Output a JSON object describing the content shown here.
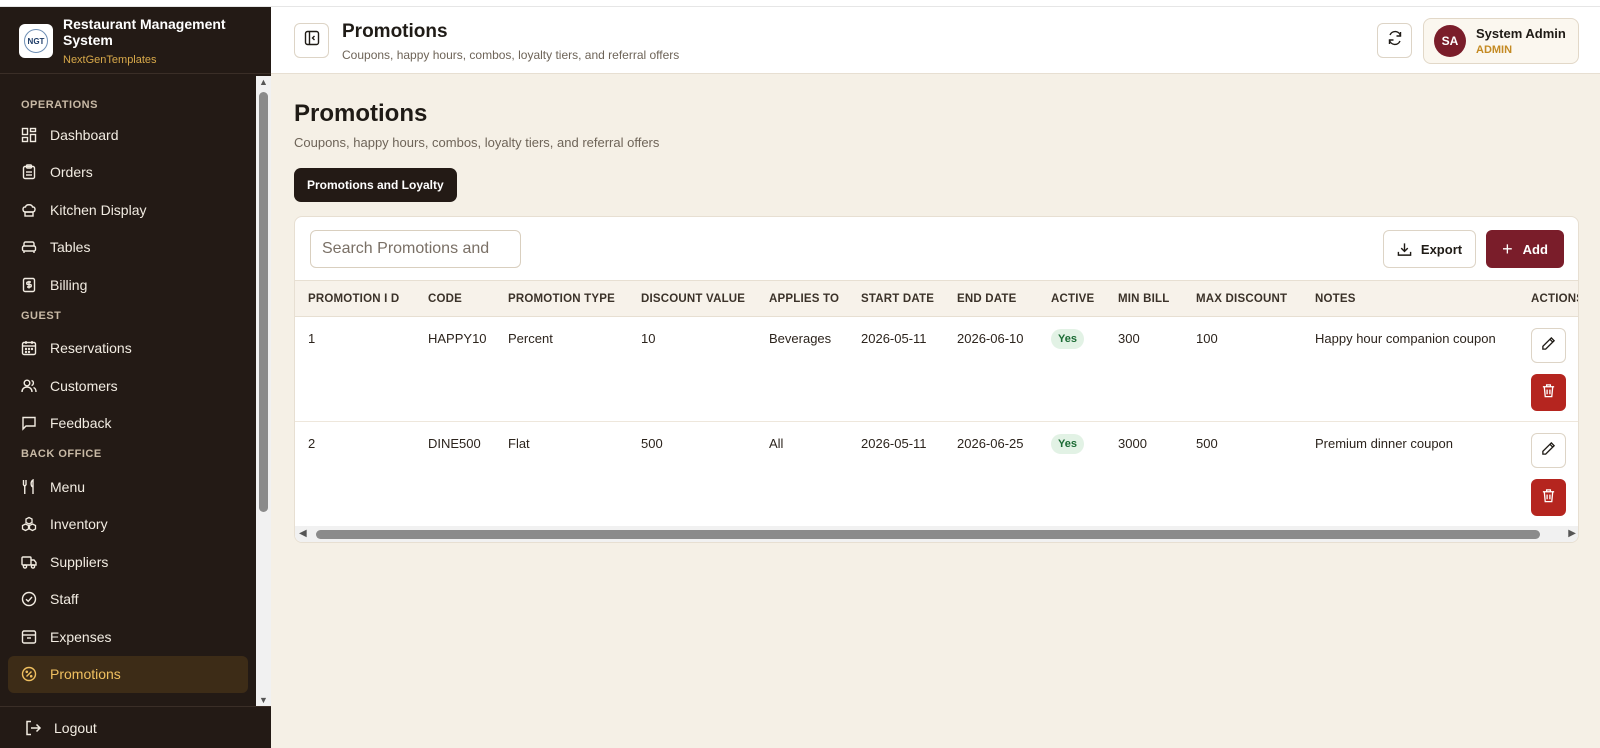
{
  "sidebar": {
    "brand_title": "Restaurant Management System",
    "brand_sub": "NextGenTemplates",
    "logo_text": "NGT",
    "sections": {
      "operations": "OPERATIONS",
      "guest": "GUEST",
      "back_office": "BACK OFFICE"
    },
    "items": {
      "dashboard": "Dashboard",
      "orders": "Orders",
      "kitchen": "Kitchen Display",
      "tables": "Tables",
      "billing": "Billing",
      "reservations": "Reservations",
      "customers": "Customers",
      "feedback": "Feedback",
      "menu": "Menu",
      "inventory": "Inventory",
      "suppliers": "Suppliers",
      "staff": "Staff",
      "expenses": "Expenses",
      "promotions": "Promotions"
    },
    "logout": "Logout"
  },
  "header": {
    "title": "Promotions",
    "subtitle": "Coupons, happy hours, combos, loyalty tiers, and referral offers",
    "user_initials": "SA",
    "user_name": "System Admin",
    "user_role": "ADMIN"
  },
  "main": {
    "title": "Promotions",
    "subtitle": "Coupons, happy hours, combos, loyalty tiers, and referral offers",
    "tab": "Promotions and Loyalty",
    "search_placeholder": "Search Promotions and",
    "export_label": "Export",
    "add_label": "Add"
  },
  "table": {
    "headers": [
      "PROMOTION I D",
      "CODE",
      "PROMOTION TYPE",
      "DISCOUNT VALUE",
      "APPLIES TO",
      "START DATE",
      "END DATE",
      "ACTIVE",
      "MIN BILL",
      "MAX DISCOUNT",
      "NOTES",
      "ACTIONS"
    ],
    "rows": [
      [
        "1",
        "HAPPY10",
        "Percent",
        "10",
        "Beverages",
        "2026-05-11",
        "2026-06-10",
        "Yes",
        "300",
        "100",
        "Happy hour companion coupon"
      ],
      [
        "2",
        "DINE500",
        "Flat",
        "500",
        "All",
        "2026-05-11",
        "2026-06-25",
        "Yes",
        "3000",
        "500",
        "Premium dinner coupon"
      ]
    ]
  },
  "colors": {
    "sidebar_bg": "#231a15",
    "accent": "#7a1d2a",
    "active_nav": "#f0c060",
    "danger": "#b5251f",
    "badge_bg": "#e2f2e5"
  }
}
